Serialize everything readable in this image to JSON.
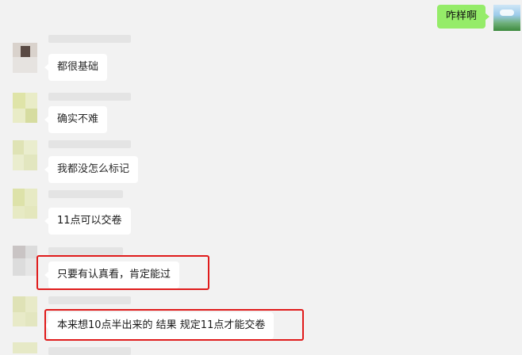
{
  "outgoing": {
    "text": "咋样啊"
  },
  "messages": [
    {
      "text": "都很基础"
    },
    {
      "text": "确实不难"
    },
    {
      "text": "我都没怎么标记"
    },
    {
      "text": "11点可以交卷"
    },
    {
      "text": "只要有认真看，肯定能过"
    },
    {
      "text": "本来想10点半出来的 结果 规定11点才能交卷"
    }
  ],
  "colors": {
    "outgoing_bubble": "#95ec69",
    "incoming_bubble": "#ffffff",
    "background": "#f2f2f2",
    "highlight": "#e01b1b"
  }
}
